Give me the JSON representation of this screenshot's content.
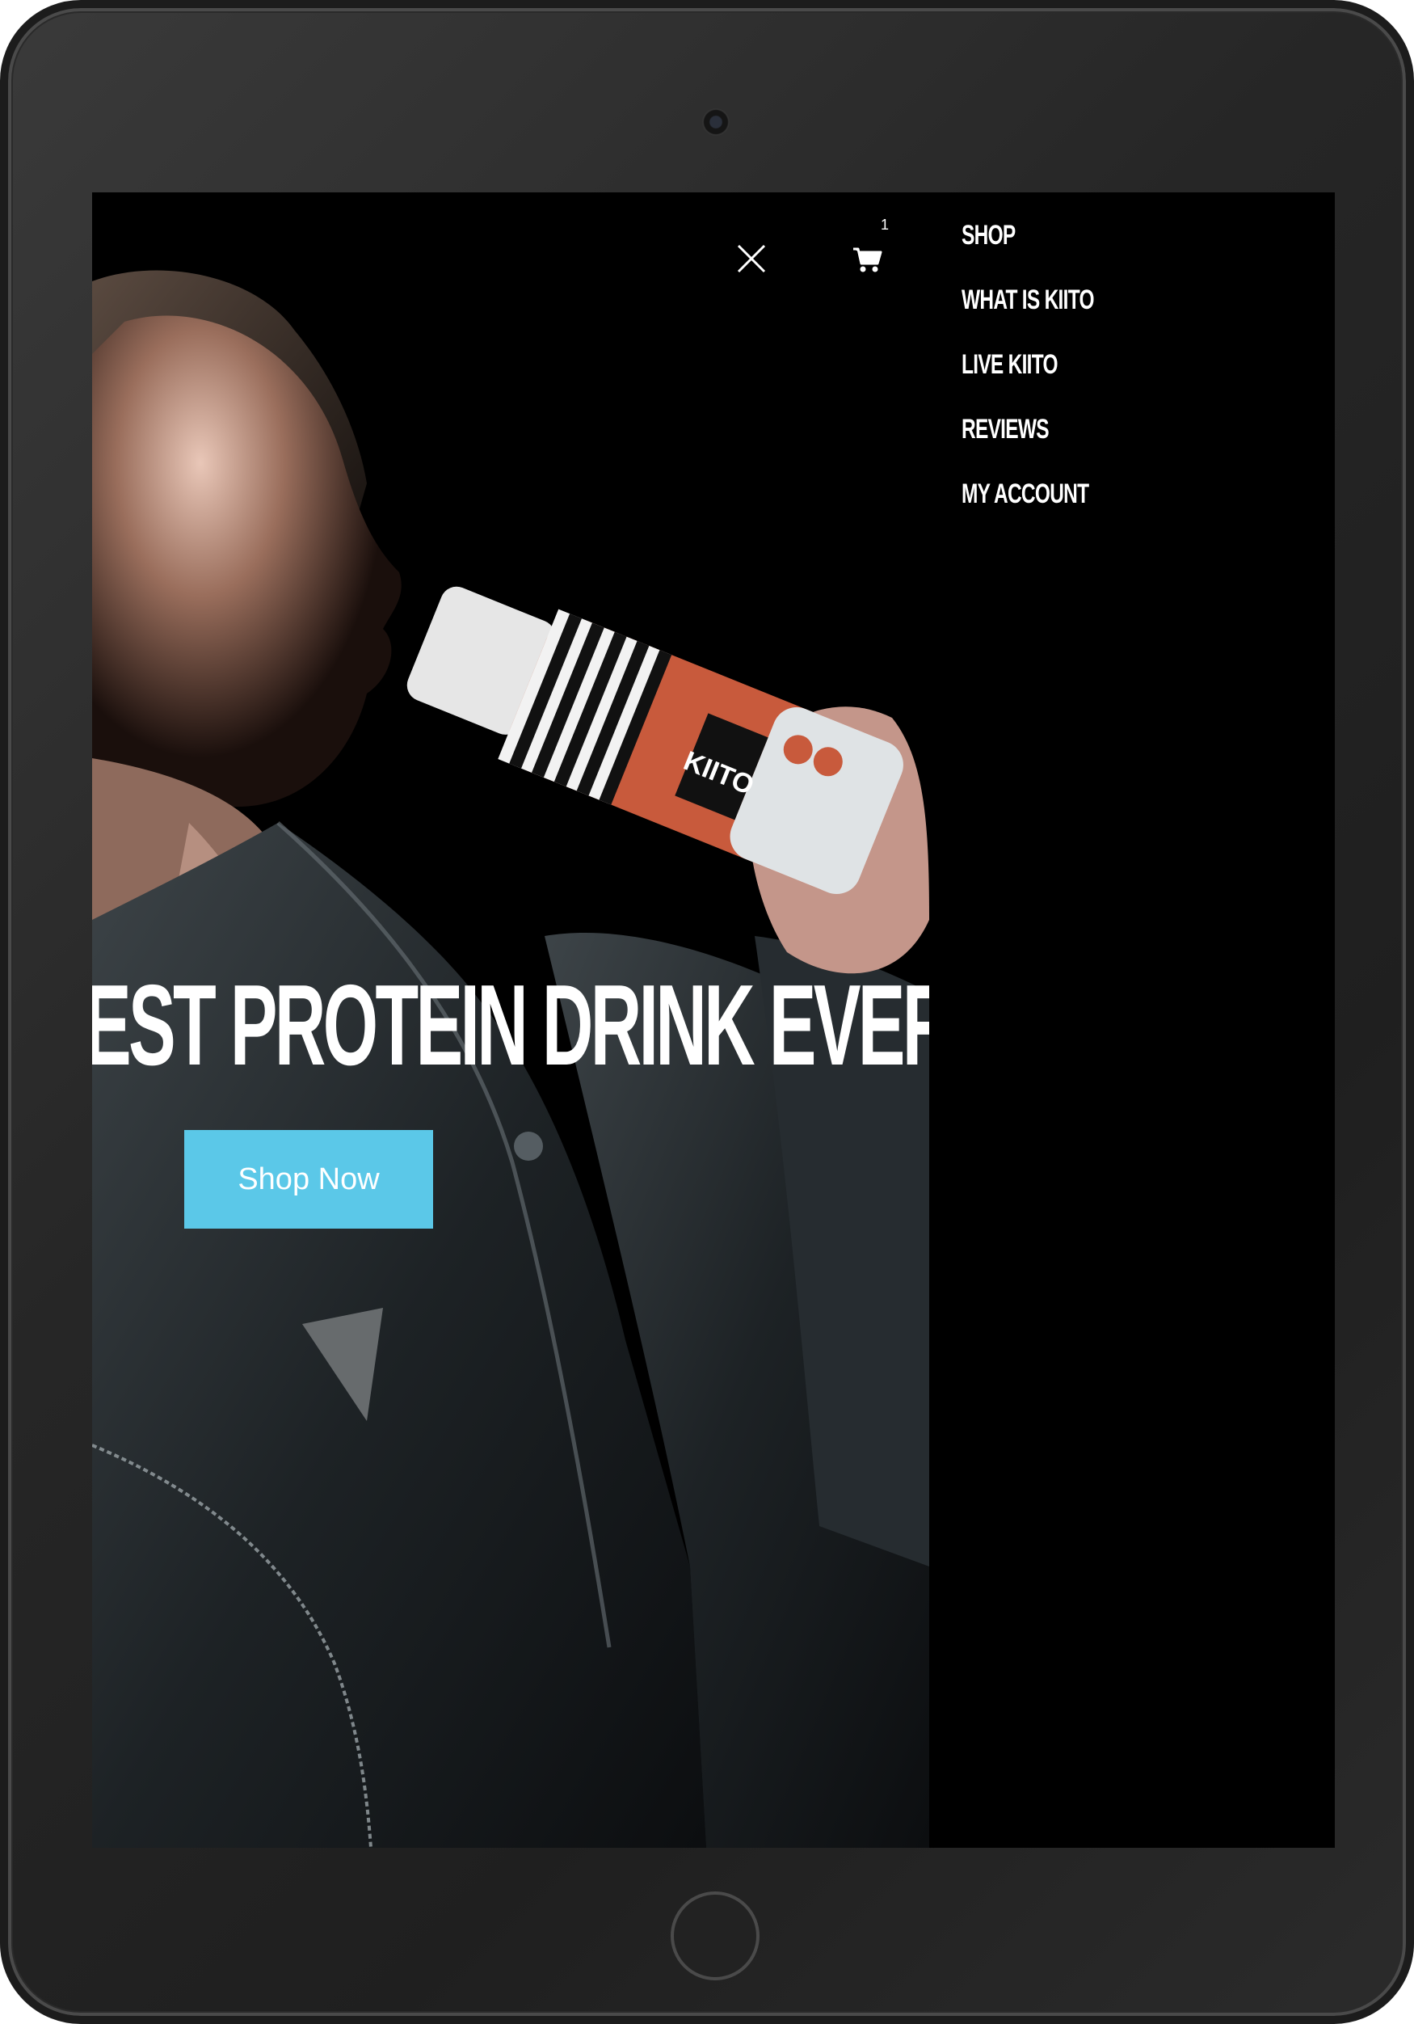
{
  "hero": {
    "headline": "EST PROTEIN DRINK EVER",
    "cta_label": "Shop Now",
    "bottle_brand": "KIITO"
  },
  "header": {
    "close_icon": "close-icon",
    "cart_icon": "cart-icon",
    "cart_count": "1"
  },
  "menu": {
    "items": [
      {
        "label": "SHOP"
      },
      {
        "label": "WHAT IS KIITO"
      },
      {
        "label": "LIVE KIITO"
      },
      {
        "label": "REVIEWS"
      },
      {
        "label": "MY ACCOUNT"
      }
    ]
  },
  "colors": {
    "accent": "#5bc8e8",
    "background": "#000000",
    "text": "#ffffff",
    "bottle_orange": "#c85a3c",
    "device_frame": "#262626"
  }
}
